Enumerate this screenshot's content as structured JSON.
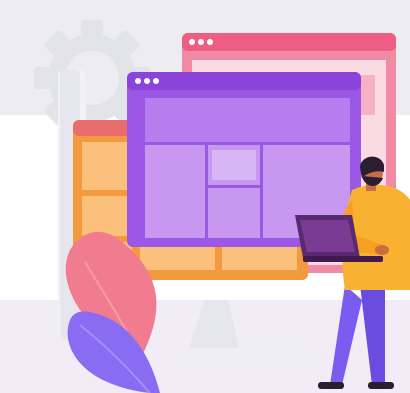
{
  "illustration": {
    "subject": "web-design-illustration",
    "icons": {
      "gear": "gear-icon",
      "window_dots": "window-dots-icon",
      "leaf": "leaf-icon",
      "laptop": "laptop-icon"
    },
    "colors": {
      "background_band": "#ececf1",
      "bottom_band": "#f0edf6",
      "gear": "#e2e4ea",
      "monitor_frame": "#f2f2f6",
      "orange_window": "#f39a3e",
      "orange_window_header": "#e96d6d",
      "pink_window": "#f08aa5",
      "pink_window_header": "#ee5d82",
      "purple_window": "#9b57e6",
      "purple_window_light": "#c898f0",
      "leaf_pink": "#f27c8f",
      "leaf_purple": "#8a6cf2",
      "person_shirt": "#f9b131",
      "person_pants": "#7a5cf0",
      "laptop": "#5a2a6e",
      "skin": "#c96e43",
      "hair": "#2b1e33"
    }
  }
}
